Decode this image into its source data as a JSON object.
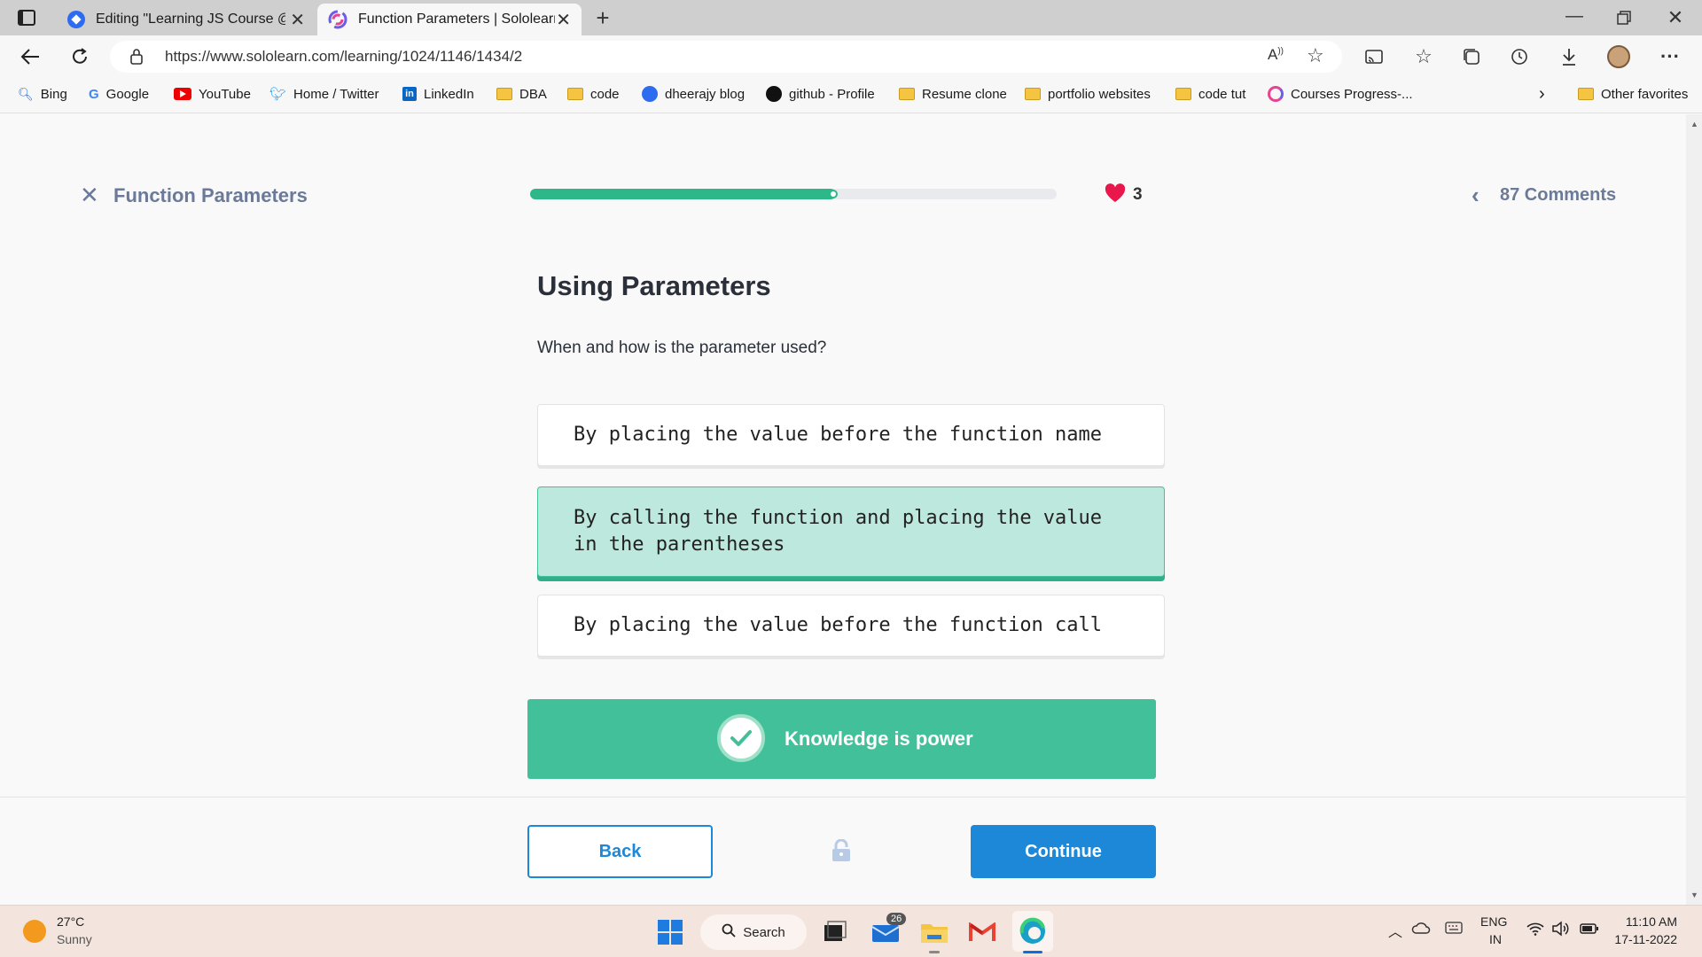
{
  "browser": {
    "tabs": [
      {
        "label": "Editing \"Learning JS Course @Sc",
        "active": false
      },
      {
        "label": "Function Parameters | Sololearn",
        "active": true
      }
    ],
    "url": "https://www.sololearn.com/learning/1024/1146/1434/2",
    "bookmarks": [
      "Bing",
      "Google",
      "YouTube",
      "Home / Twitter",
      "LinkedIn",
      "DBA",
      "code",
      "dheerajy blog",
      "github - Profile",
      "Resume clone",
      "portfolio websites",
      "code tut",
      "Courses Progress-...",
      "Other favorites"
    ]
  },
  "lesson": {
    "title": "Function Parameters",
    "progress_fraction": 0.58,
    "hearts": "3",
    "comments": "87 Comments",
    "heading": "Using Parameters",
    "question": "When and how is the parameter used?",
    "options": [
      {
        "text": "By placing the value before the function name",
        "selected": false
      },
      {
        "text": "By calling the function and placing the value in the parentheses",
        "selected": true
      },
      {
        "text": "By placing the value before the function call",
        "selected": false
      }
    ],
    "feedback": "Knowledge is power",
    "back_label": "Back",
    "continue_label": "Continue"
  },
  "taskbar": {
    "temperature": "27°C",
    "weather": "Sunny",
    "search_label": "Search",
    "mail_badge": "26",
    "lang_top": "ENG",
    "lang_bottom": "IN",
    "time": "11:10 AM",
    "date": "17-11-2022"
  },
  "colors": {
    "accent_green": "#42c09a",
    "progress_green": "#2eb88a",
    "continue_blue": "#1e88d8",
    "heart_red": "#e8174c"
  }
}
